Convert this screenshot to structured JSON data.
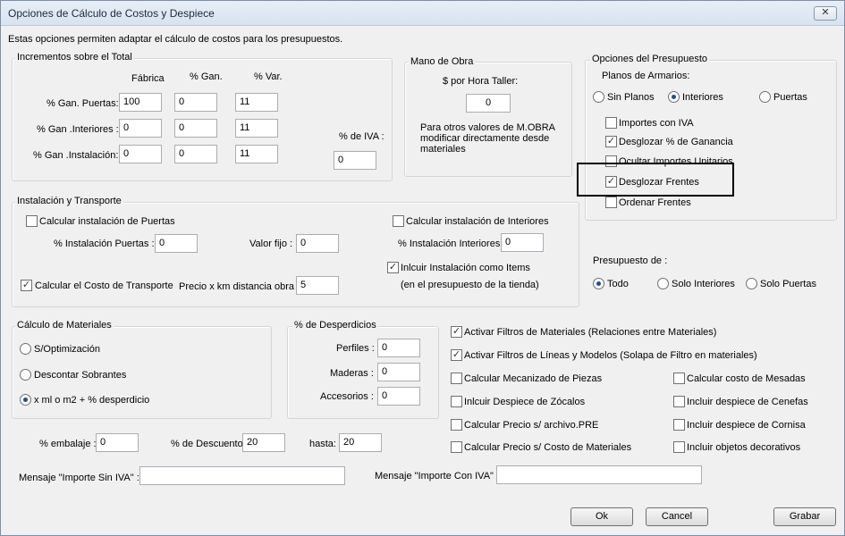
{
  "window": {
    "title": "Opciones de Cálculo de Costos y Despiece",
    "close_glyph": "✕"
  },
  "intro": "Estas opciones permiten adaptar el cálculo de costos para los presupuestos.",
  "incrementos": {
    "group_label": "Incrementos sobre el Total",
    "col_fabrica": "Fábrica",
    "col_gan": "% Gan.",
    "col_var": "% Var.",
    "rows": [
      {
        "label": "% Gan. Puertas:",
        "fabrica": "100",
        "gan": "0",
        "var": "11"
      },
      {
        "label": "% Gan .Interiores :",
        "fabrica": "0",
        "gan": "0",
        "var": "11"
      },
      {
        "label": "% Gan .Instalación:",
        "fabrica": "0",
        "gan": "0",
        "var": "11"
      }
    ],
    "iva_label": "% de IVA :",
    "iva_value": "0"
  },
  "mano_obra": {
    "group_label": "Mano de Obra",
    "hora_label": "$ por Hora Taller:",
    "hora_value": "0",
    "note_1": "Para otros valores de M.OBRA",
    "note_2": "modificar directamente desde",
    "note_3": "materiales"
  },
  "opciones_presupuesto": {
    "group_label": "Opciones del Presupuesto",
    "planos_label": "Planos de Armarios:",
    "radios": [
      "Sin Planos",
      "Interiores",
      "Puertas"
    ],
    "selected": "Interiores",
    "checks": [
      {
        "label": "Importes con IVA",
        "checked": false
      },
      {
        "label": "Desglozar % de Ganancia",
        "checked": true
      },
      {
        "label": "Ocultar Importes Unitarios",
        "checked": false
      },
      {
        "label": "Desglozar Frentes",
        "checked": true
      },
      {
        "label": "Ordenar Frentes",
        "checked": false
      }
    ]
  },
  "instalacion": {
    "group_label": "Instalación y Transporte",
    "calc_puertas": "Calcular instalación de Puertas",
    "pct_puertas_label": "% Instalación Puertas :",
    "pct_puertas_value": "0",
    "valor_fijo_label": "Valor fijo :",
    "valor_fijo_value": "0",
    "calc_interiores": "Calcular instalación de Interiores",
    "pct_interiores_label": "% Instalación Interiores :",
    "pct_interiores_value": "0",
    "incluir_items": "Inlcuir Instalación como Items",
    "incluir_note": "(en el presupuesto de la tienda)",
    "calc_transporte": "Calcular el Costo de Transporte",
    "precio_km_label": "Precio x km distancia obra :",
    "precio_km_value": "5"
  },
  "presupuesto_de": {
    "label": "Presupuesto de :",
    "radios": [
      "Todo",
      "Solo Interiores",
      "Solo Puertas"
    ],
    "selected": "Todo"
  },
  "calculo_materiales": {
    "group_label": "Cálculo de Materiales",
    "radios": [
      "S/Optimización",
      "Descontar Sobrantes",
      "x ml o m2 + % desperdicio"
    ],
    "selected": "x ml o m2 + % desperdicio"
  },
  "desperdicios": {
    "group_label": "% de Desperdicios",
    "perfiles_label": "Perfiles :",
    "perfiles_value": "0",
    "maderas_label": "Maderas :",
    "maderas_value": "0",
    "accesorios_label": "Accesorios :",
    "accesorios_value": "0"
  },
  "filtros": {
    "activar_materiales": "Activar Filtros de Materiales (Relaciones entre Materiales)",
    "activar_lineas": "Activar Filtros de Líneas y Modelos (Solapa de Filtro en materiales)",
    "left": [
      {
        "label": "Calcular Mecanizado de Piezas",
        "checked": false
      },
      {
        "label": "Inlcuir Despiece de Zócalos",
        "checked": false
      },
      {
        "label": "Calcular Precio s/ archivo.PRE",
        "checked": false
      },
      {
        "label": "Calcular Precio s/ Costo de Materiales",
        "checked": false
      }
    ],
    "right": [
      {
        "label": "Calcular costo de Mesadas",
        "checked": false
      },
      {
        "label": "Incluir despiece de Cenefas",
        "checked": false
      },
      {
        "label": "Incluir despiece de Cornisa",
        "checked": false
      },
      {
        "label": "Incluir objetos decorativos",
        "checked": false
      }
    ]
  },
  "bottom": {
    "embalaje_label": "% embalaje :",
    "embalaje_value": "0",
    "descuento_label": "% de Descuento:",
    "descuento_value": "20",
    "hasta_label": "hasta:",
    "hasta_value": "20",
    "msg_sin_iva_label": "Mensaje \"Importe Sin IVA\" :",
    "msg_sin_iva_value": "",
    "msg_con_iva_label": "Mensaje \"Importe Con IVA\" :",
    "msg_con_iva_value": ""
  },
  "buttons": {
    "ok": "Ok",
    "cancel": "Cancel",
    "grabar": "Grabar"
  },
  "check_glyph": "✓"
}
